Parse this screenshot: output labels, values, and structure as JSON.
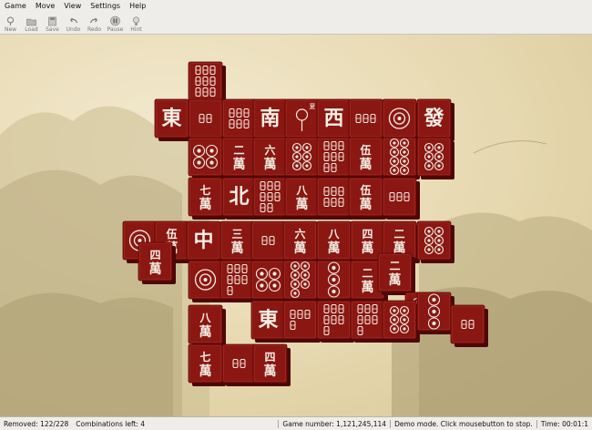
{
  "menu": [
    {
      "label": "Game",
      "name": "menu-game"
    },
    {
      "label": "Move",
      "name": "menu-move"
    },
    {
      "label": "View",
      "name": "menu-view"
    },
    {
      "label": "Settings",
      "name": "menu-settings"
    },
    {
      "label": "Help",
      "name": "menu-help"
    }
  ],
  "toolbar": [
    {
      "label": "New",
      "icon": "new-icon"
    },
    {
      "label": "Load",
      "icon": "load-icon"
    },
    {
      "label": "Save",
      "icon": "save-icon"
    },
    {
      "label": "Undo",
      "icon": "undo-icon"
    },
    {
      "label": "Redo",
      "icon": "redo-icon"
    },
    {
      "label": "Pause",
      "icon": "pause-icon"
    },
    {
      "label": "Hint",
      "icon": "hint-icon"
    }
  ],
  "status": {
    "removed": "Removed: 122/228",
    "combinations": "Combinations left: 4",
    "game_number": "Game number: 1,121,245,114",
    "demo": "Demo mode. Click mousebutton to stop.",
    "time": "Time: 00:01:1"
  },
  "colors": {
    "tile_face": "#8a1712",
    "tile_edge": "#4d0705",
    "tile_glyph": "#f6efe4",
    "background": "#e9dcb6"
  },
  "tiles": [
    {
      "glyph": "9bam"
    },
    {
      "glyph": "東"
    },
    {
      "glyph": "2bam"
    },
    {
      "glyph": "6bam"
    },
    {
      "glyph": "南"
    },
    {
      "glyph": "flower",
      "tag": "夏"
    },
    {
      "glyph": "西"
    },
    {
      "glyph": "3bam"
    },
    {
      "glyph": "1dot"
    },
    {
      "glyph": "發"
    },
    {
      "glyph": "4dot"
    },
    {
      "glyph": "二萬"
    },
    {
      "glyph": "六萬"
    },
    {
      "glyph": "6dot"
    },
    {
      "glyph": "8bam"
    },
    {
      "glyph": "伍萬"
    },
    {
      "glyph": "8dot"
    },
    {
      "glyph": "6dot"
    },
    {
      "glyph": "七萬"
    },
    {
      "glyph": "北"
    },
    {
      "glyph": "8bam"
    },
    {
      "glyph": "八萬"
    },
    {
      "glyph": "6bam"
    },
    {
      "glyph": "伍萬"
    },
    {
      "glyph": "3bam"
    },
    {
      "glyph": "1dot"
    },
    {
      "glyph": "伍萬"
    },
    {
      "glyph": "中"
    },
    {
      "glyph": "三萬"
    },
    {
      "glyph": "2bam"
    },
    {
      "glyph": "六萬"
    },
    {
      "glyph": "八萬"
    },
    {
      "glyph": "四萬"
    },
    {
      "glyph": "二萬"
    },
    {
      "glyph": "6dot"
    },
    {
      "glyph": "四萬"
    },
    {
      "glyph": "1dot"
    },
    {
      "glyph": "7bam"
    },
    {
      "glyph": "4dot"
    },
    {
      "glyph": "7dot"
    },
    {
      "glyph": "3dot"
    },
    {
      "glyph": "二萬"
    },
    {
      "glyph": "二萬"
    },
    {
      "glyph": "6dot"
    },
    {
      "glyph": "八萬"
    },
    {
      "glyph": "東"
    },
    {
      "glyph": "4bam"
    },
    {
      "glyph": "7bam"
    },
    {
      "glyph": "7bam"
    },
    {
      "glyph": "6dot"
    },
    {
      "glyph": "3dot"
    },
    {
      "glyph": "2bam"
    },
    {
      "glyph": "七萬"
    },
    {
      "glyph": "2bam"
    },
    {
      "glyph": "四萬"
    }
  ]
}
